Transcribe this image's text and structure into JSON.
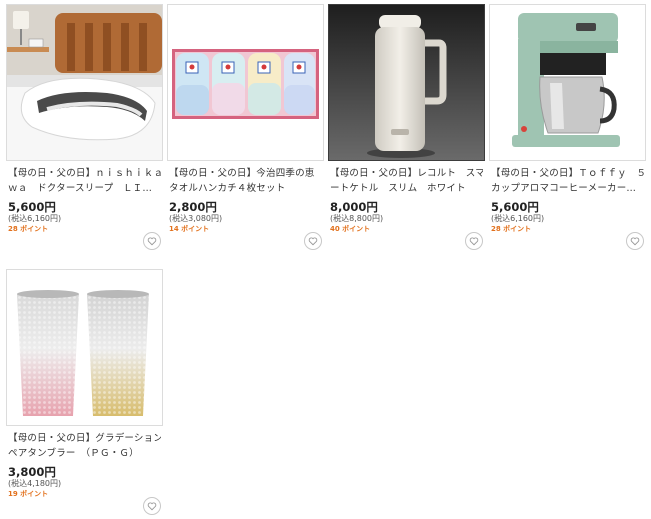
{
  "products": [
    {
      "title_line1": "【母の日・父の日】ｎｉｓｈｉｋａ",
      "title_line2": "ｗａ　ドクタースリープ　ＬＩＧ…",
      "price": "5,600円",
      "tax_included": "(税込6,160円)",
      "points": "28 ポイント",
      "image": "pillow-image",
      "favorite_icon": "heart-icon"
    },
    {
      "title_line1": "【母の日・父の日】今治四季の恵",
      "title_line2": "タオルハンカチ４枚セット",
      "price": "2,800円",
      "tax_included": "(税込3,080円)",
      "points": "14 ポイント",
      "image": "towel-handkerchief-set-image",
      "favorite_icon": "heart-icon"
    },
    {
      "title_line1": "【母の日・父の日】レコルト　スマ",
      "title_line2": "ートケトル　スリム　ホワイト",
      "price": "8,000円",
      "tax_included": "(税込8,800円)",
      "points": "40 ポイント",
      "image": "kettle-image",
      "favorite_icon": "heart-icon"
    },
    {
      "title_line1": "【母の日・父の日】Ｔｏｆｆｙ　５",
      "title_line2": "カップアロマコーヒーメーカーペ…",
      "price": "5,600円",
      "tax_included": "(税込6,160円)",
      "points": "28 ポイント",
      "image": "coffee-maker-image",
      "favorite_icon": "heart-icon"
    },
    {
      "title_line1": "【母の日・父の日】グラデーション",
      "title_line2": "ペアタンブラー　（ＰＧ・Ｇ）",
      "price": "3,800円",
      "tax_included": "(税込4,180円)",
      "points": "19 ポイント",
      "image": "tumbler-pair-image",
      "favorite_icon": "heart-icon"
    }
  ],
  "colors": {
    "points": "#e2711d",
    "border": "#dcdcdc",
    "text": "#333333"
  }
}
